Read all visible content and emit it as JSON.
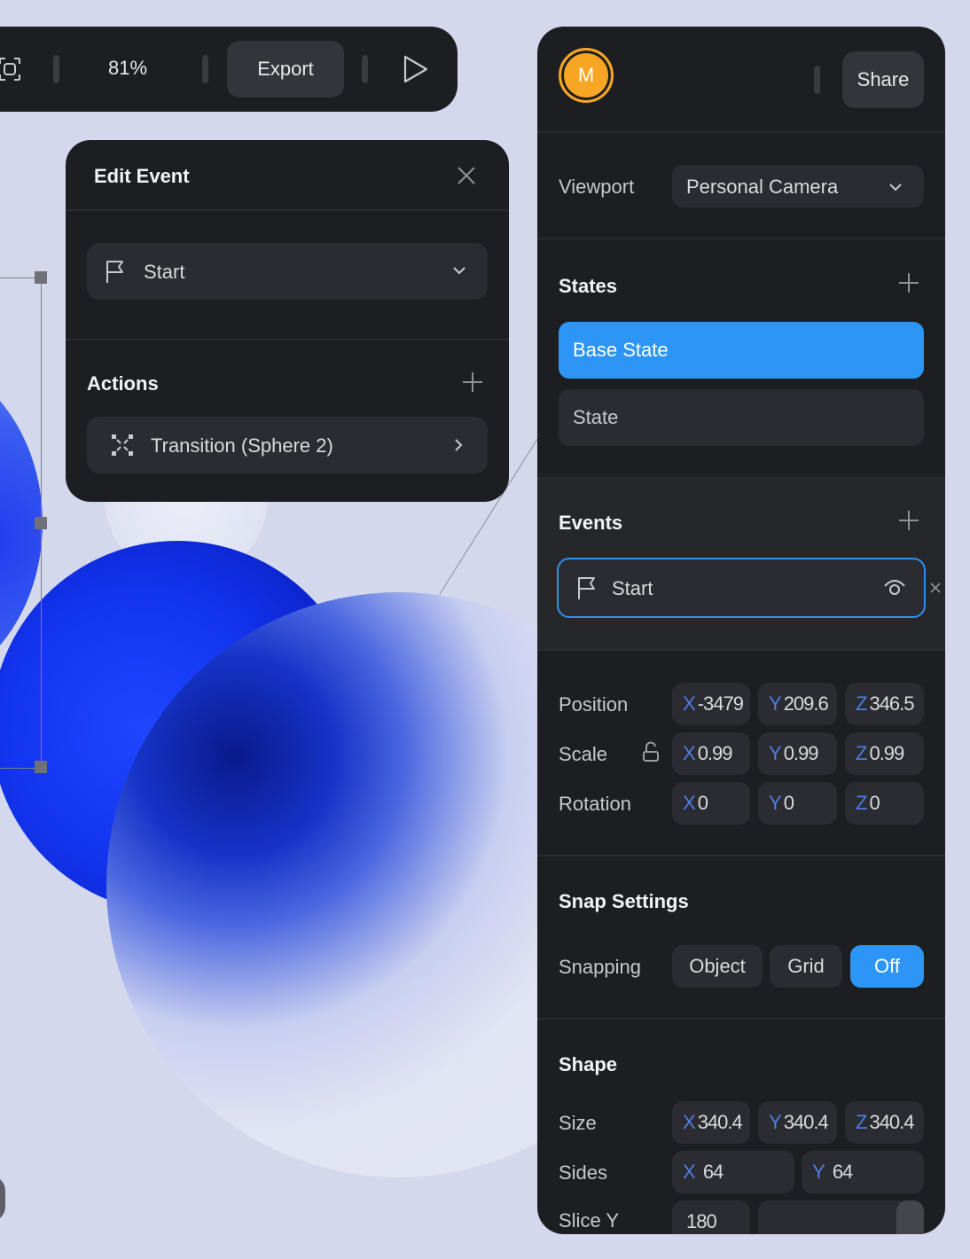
{
  "toolbar": {
    "zoom": "81%",
    "export_label": "Export",
    "icons": [
      "frame-icon",
      "play-icon"
    ]
  },
  "edit_event": {
    "title": "Edit Event",
    "trigger": {
      "label": "Start",
      "icon": "flag-icon"
    },
    "actions_title": "Actions",
    "action": {
      "label": "Transition (Sphere 2)",
      "icon": "transition-icon"
    }
  },
  "panel": {
    "avatar_initial": "M",
    "share_label": "Share",
    "viewport": {
      "label": "Viewport",
      "value": "Personal Camera"
    },
    "states": {
      "title": "States",
      "items": [
        "Base State",
        "State"
      ],
      "active_color": "#2d95f5"
    },
    "events": {
      "title": "Events",
      "item": "Start"
    },
    "transform": {
      "position": {
        "label": "Position",
        "x": "-3479",
        "y": "209.6",
        "z": "346.5"
      },
      "scale": {
        "label": "Scale",
        "x": "0.99",
        "y": "0.99",
        "z": "0.99"
      },
      "rotation": {
        "label": "Rotation",
        "x": "0",
        "y": "0",
        "z": "0"
      }
    },
    "axis": {
      "x": "X",
      "y": "Y",
      "z": "Z"
    },
    "snap": {
      "title": "Snap Settings",
      "label": "Snapping",
      "options": [
        "Object",
        "Grid",
        "Off"
      ],
      "selected": "Off"
    },
    "shape": {
      "title": "Shape",
      "size": {
        "label": "Size",
        "x": "340.4",
        "y": "340.4",
        "z": "340.4"
      },
      "sides": {
        "label": "Sides",
        "x": "64",
        "y": "64"
      },
      "slice_y": {
        "label": "Slice Y",
        "value": "180"
      }
    }
  }
}
